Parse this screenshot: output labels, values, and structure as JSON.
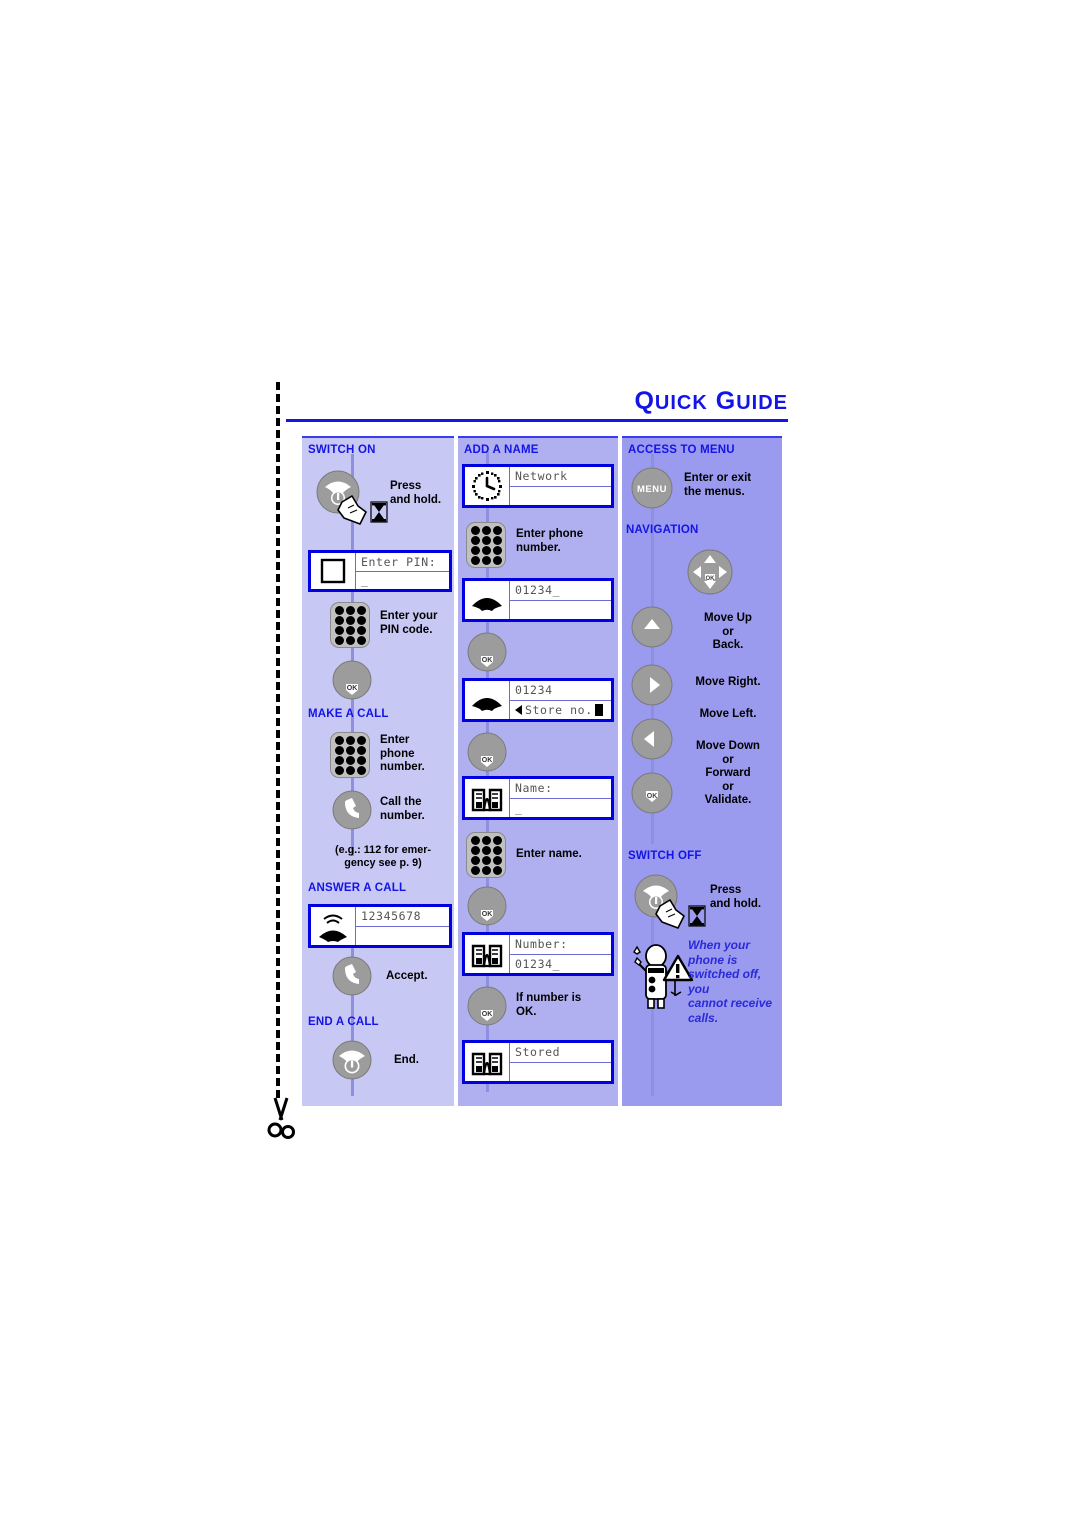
{
  "title": {
    "part1_cap": "Q",
    "part1_rest": "UICK",
    "part2_cap": "G",
    "part2_rest": "UIDE"
  },
  "colors": {
    "accent_blue": "#1414e6",
    "screen_border": "#0000e0",
    "col_left_bg": "#c8c8f5",
    "col_mid_bg": "#b0b0f0",
    "col_right_bg": "#9a9aee",
    "key_gray": "#9c9c9c"
  },
  "columns": {
    "left": {
      "sections": [
        {
          "id": "switch-on",
          "heading": "SWITCH ON"
        },
        {
          "id": "make-a-call",
          "heading": "MAKE A CALL"
        },
        {
          "id": "answer-a-call",
          "heading": "ANSWER A CALL"
        },
        {
          "id": "end-a-call",
          "heading": "END A CALL"
        }
      ],
      "steps": {
        "press_and_hold": "Press\nand hold.",
        "press_and_hold_l1": "Press",
        "press_and_hold_l2": "and hold.",
        "enter_your_pin_l1": "Enter your",
        "enter_your_pin_l2": "PIN code.",
        "enter_phone_number_l1": "Enter",
        "enter_phone_number_l2": "phone",
        "enter_phone_number_l3": "number.",
        "call_the_number_l1": "Call the",
        "call_the_number_l2": "number.",
        "emergency_l1": "(e.g.: 112 for emer-",
        "emergency_l2": "gency see p. 9)",
        "accept": "Accept.",
        "end": "End."
      },
      "screens": {
        "pin": {
          "icon": "blank-square-icon",
          "line1": "Enter PIN:",
          "line2": "_"
        },
        "incoming": {
          "icon": "ringing-handset-icon",
          "line1": "12345678",
          "line2": ""
        }
      }
    },
    "mid": {
      "sections": [
        {
          "id": "add-a-name",
          "heading": "ADD A NAME"
        }
      ],
      "steps": {
        "enter_phone_number_l1": "Enter phone",
        "enter_phone_number_l2": "number.",
        "enter_name": "Enter name.",
        "if_number_ok_l1": "If number is",
        "if_number_ok_l2": "OK."
      },
      "screens": {
        "network": {
          "icon": "clock-icon",
          "line1": "Network",
          "line2": ""
        },
        "dialing": {
          "icon": "handset-icon",
          "line1": "01234_",
          "line2": ""
        },
        "store": {
          "icon": "handset-icon",
          "line1": "01234",
          "line2": "Store no.",
          "has_left_arrow": true,
          "has_cursor": true
        },
        "name": {
          "icon": "phonebook-icon",
          "line1": "Name:",
          "line2": "_"
        },
        "number": {
          "icon": "phonebook-icon",
          "line1": "Number:",
          "line2": "01234_"
        },
        "stored": {
          "icon": "phonebook-icon",
          "line1": "Stored",
          "line2": ""
        }
      }
    },
    "right": {
      "sections": [
        {
          "id": "access-to-menu",
          "heading": "ACCESS TO MENU"
        },
        {
          "id": "navigation",
          "heading": "NAVIGATION"
        },
        {
          "id": "switch-off",
          "heading": "SWITCH OFF"
        }
      ],
      "steps": {
        "menu_l1": "Enter or exit",
        "menu_l2": "the menus.",
        "up_l1": "Move Up",
        "up_l2": "or",
        "up_l3": "Back.",
        "right": "Move Right.",
        "left": "Move Left.",
        "down_l1": "Move Down",
        "down_l2": "or",
        "down_l3": "Forward",
        "down_l4": "or",
        "down_l5": "Validate.",
        "press_and_hold_l1": "Press",
        "press_and_hold_l2": "and hold."
      },
      "menu_key_label": "MENU",
      "warning_note_l1": "When your",
      "warning_note_l2": "phone is",
      "warning_note_l3": "switched off, you",
      "warning_note_l4": "cannot receive",
      "warning_note_l5": "calls."
    }
  }
}
